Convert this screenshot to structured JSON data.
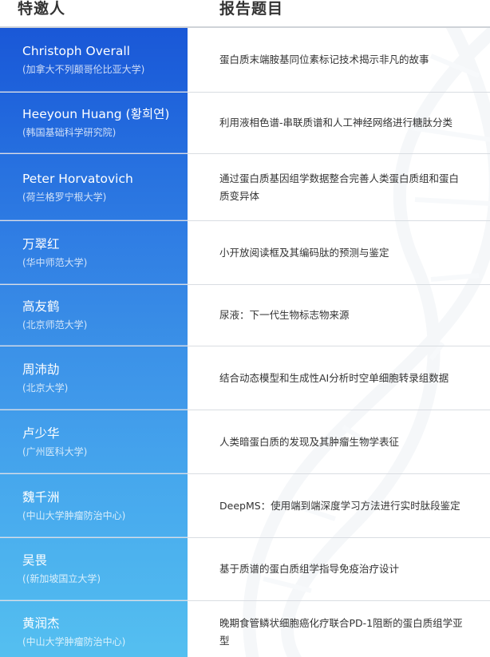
{
  "header": {
    "speaker_label": "特邀人",
    "topic_label": "报告题目"
  },
  "rows": [
    {
      "name": "Christoph Overall",
      "affiliation": "(加拿大不列颠哥伦比亚大学)",
      "topic": "蛋白质末端胺基同位素标记技术揭示非凡的故事"
    },
    {
      "name": "Heeyoun Huang (황희연)",
      "affiliation": "(韩国基础科学研究院)",
      "topic": "利用液相色谱-串联质谱和人工神经网络进行糖肽分类"
    },
    {
      "name": "Peter Horvatovich",
      "affiliation": "(荷兰格罗宁根大学)",
      "topic": "通过蛋白质基因组学数据整合完善人类蛋白质组和蛋白质变异体"
    },
    {
      "name": "万翠红",
      "affiliation": "(华中师范大学)",
      "topic": "小开放阅读框及其编码肽的预测与鉴定"
    },
    {
      "name": "高友鹤",
      "affiliation": "(北京师范大学)",
      "topic": "尿液：下一代生物标志物来源"
    },
    {
      "name": "周沛劼",
      "affiliation": "(北京大学)",
      "topic": "结合动态模型和生成性AI分析时空单细胞转录组数据"
    },
    {
      "name": "卢少华",
      "affiliation": "(广州医科大学)",
      "topic": "人类暗蛋白质的发现及其肿瘤生物学表征"
    },
    {
      "name": "魏千洲",
      "affiliation": "(中山大学肿瘤防治中心)",
      "topic": "DeepMS：使用端到端深度学习方法进行实时肽段鉴定"
    },
    {
      "name": "吴畏",
      "affiliation": "((新加坡国立大学)",
      "topic": "基于质谱的蛋白质组学指导免疫治疗设计"
    },
    {
      "name": "黄润杰",
      "affiliation": "(中山大学肿瘤防治中心)",
      "topic": "晚期食管鳞状细胞癌化疗联合PD-1阻断的蛋白质组学亚型"
    }
  ],
  "colors": {
    "gradient_top": "#1a5bd8",
    "gradient_bottom": "#4bbcec",
    "header_text": "#333333",
    "topic_text": "#333333"
  }
}
